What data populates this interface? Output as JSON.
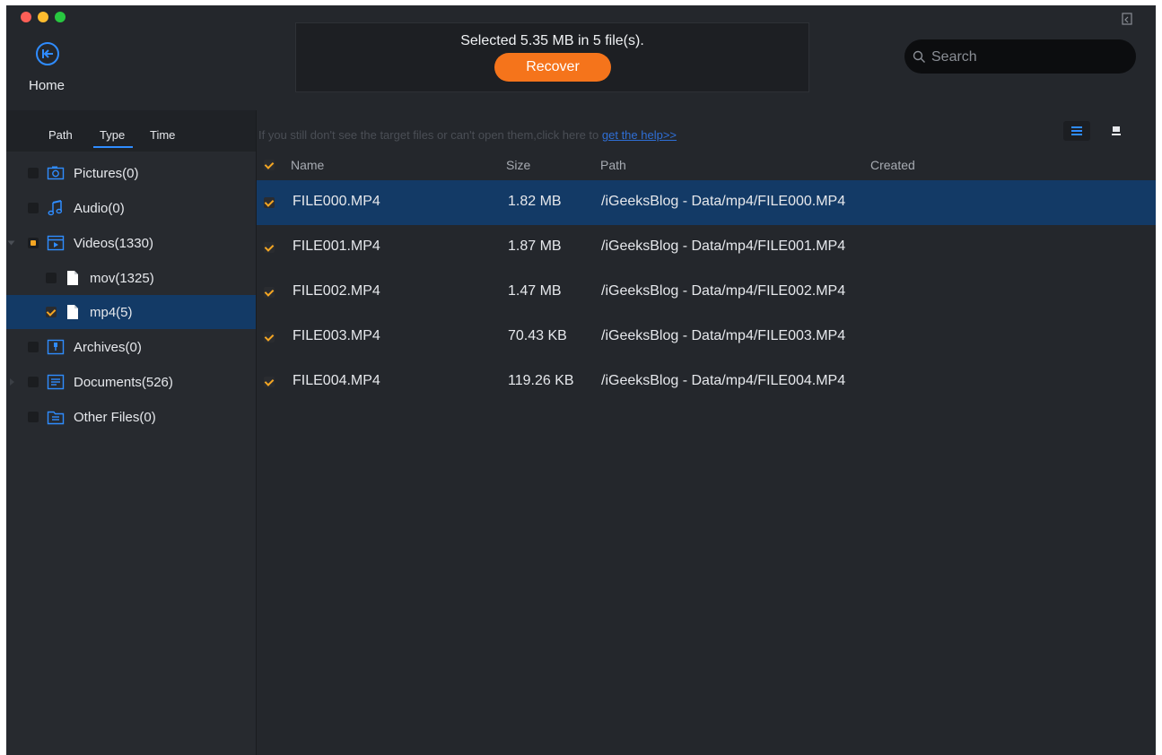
{
  "header": {
    "home_label": "Home",
    "selection_summary": "Selected 5.35 MB in 5 file(s).",
    "recover_label": "Recover",
    "search_placeholder": "Search"
  },
  "sidebar": {
    "tabs": [
      {
        "label": "Path",
        "active": false
      },
      {
        "label": "Type",
        "active": true
      },
      {
        "label": "Time",
        "active": false
      }
    ],
    "items": [
      {
        "label": "Pictures(0)",
        "icon": "camera-icon",
        "checked": false,
        "depth": 0
      },
      {
        "label": "Audio(0)",
        "icon": "music-note-icon",
        "checked": false,
        "depth": 0
      },
      {
        "label": "Videos(1330)",
        "icon": "video-folder-icon",
        "checked": "partial",
        "depth": 0,
        "expanded": true
      },
      {
        "label": "mov(1325)",
        "icon": "file-icon",
        "checked": false,
        "depth": 1
      },
      {
        "label": "mp4(5)",
        "icon": "file-icon",
        "checked": true,
        "depth": 1,
        "selected": true
      },
      {
        "label": "Archives(0)",
        "icon": "archive-icon",
        "checked": false,
        "depth": 0
      },
      {
        "label": "Documents(526)",
        "icon": "document-icon",
        "checked": false,
        "depth": 0
      },
      {
        "label": "Other Files(0)",
        "icon": "folder-icon",
        "checked": false,
        "depth": 0
      }
    ]
  },
  "content": {
    "hint_text": "If you still don't see the target files or can't open them,click here to ",
    "hint_link": "get the help>>",
    "columns": {
      "name": "Name",
      "size": "Size",
      "path": "Path",
      "created": "Created"
    },
    "rows": [
      {
        "name": "FILE000.MP4",
        "size": "1.82 MB",
        "path": "/iGeeksBlog - Data/mp4/FILE000.MP4",
        "created": "",
        "checked": true,
        "selected": true
      },
      {
        "name": "FILE001.MP4",
        "size": "1.87 MB",
        "path": "/iGeeksBlog - Data/mp4/FILE001.MP4",
        "created": "",
        "checked": true,
        "selected": false
      },
      {
        "name": "FILE002.MP4",
        "size": "1.47 MB",
        "path": "/iGeeksBlog - Data/mp4/FILE002.MP4",
        "created": "",
        "checked": true,
        "selected": false
      },
      {
        "name": "FILE003.MP4",
        "size": "70.43 KB",
        "path": "/iGeeksBlog - Data/mp4/FILE003.MP4",
        "created": "",
        "checked": true,
        "selected": false
      },
      {
        "name": "FILE004.MP4",
        "size": "119.26 KB",
        "path": "/iGeeksBlog - Data/mp4/FILE004.MP4",
        "created": "",
        "checked": true,
        "selected": false
      }
    ]
  },
  "colors": {
    "window_bg": "#24272c",
    "sidebar_bg": "#272a2f",
    "selection_bg": "#133a66",
    "accent_orange": "#f5741b",
    "check_orange": "#f5a623",
    "accent_blue": "#2f8cff",
    "link_blue": "#2f6fd6"
  }
}
